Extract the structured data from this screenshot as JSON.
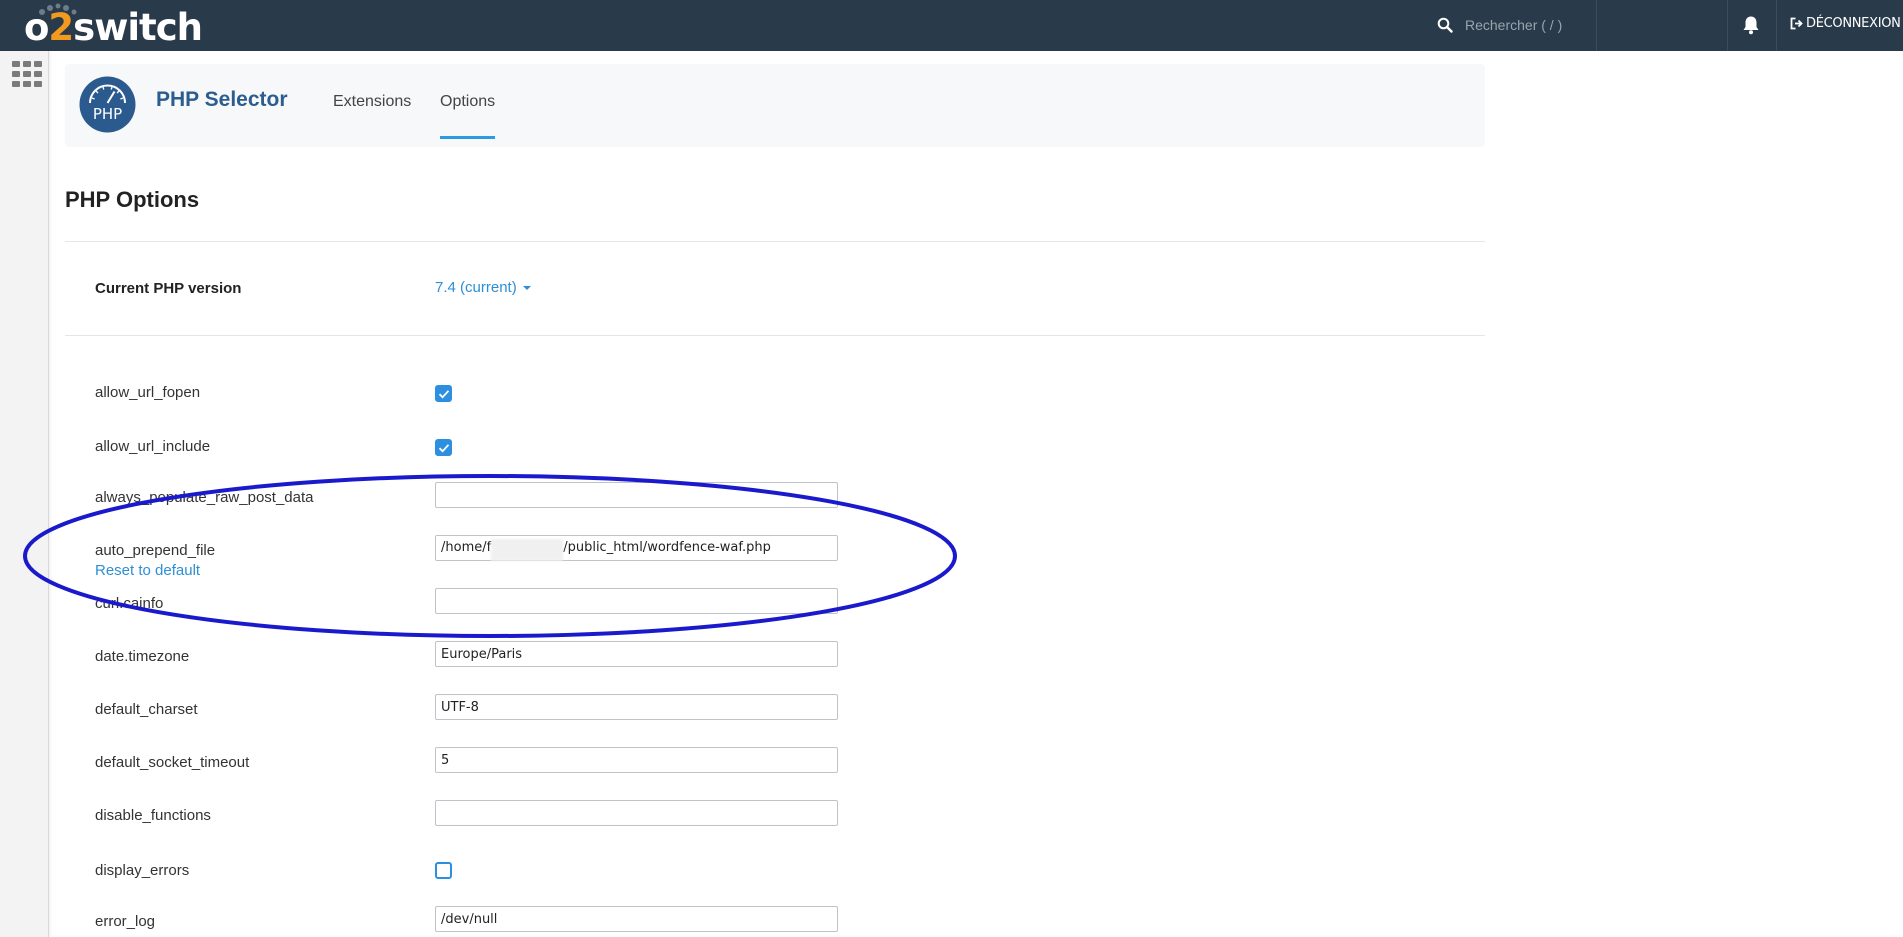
{
  "brand": {
    "logo_pre": "o",
    "logo_two": "2",
    "logo_post": "switch"
  },
  "topbar": {
    "search_placeholder": "Rechercher ( / )",
    "logout_label": "DÉCONNEXION"
  },
  "header": {
    "logo_text": "PHP",
    "title": "PHP Selector",
    "tabs": [
      {
        "label": "Extensions"
      },
      {
        "label": "Options"
      }
    ]
  },
  "page": {
    "title": "PHP Options",
    "version_label": "Current PHP version",
    "version_value": "7.4 (current)"
  },
  "options": [
    {
      "name": "allow_url_fopen",
      "type": "checkbox",
      "checked": true
    },
    {
      "name": "allow_url_include",
      "type": "checkbox",
      "checked": true
    },
    {
      "name": "always_populate_raw_post_data",
      "type": "text",
      "value": ""
    },
    {
      "name": "auto_prepend_file",
      "type": "text",
      "value_prefix": "/home/f",
      "value_suffix": "/public_html/wordfence-waf.php",
      "reset_label": "Reset to default"
    },
    {
      "name": "curl.cainfo",
      "type": "text",
      "value": ""
    },
    {
      "name": "date.timezone",
      "type": "text",
      "value": "Europe/Paris"
    },
    {
      "name": "default_charset",
      "type": "text",
      "value": "UTF-8"
    },
    {
      "name": "default_socket_timeout",
      "type": "text",
      "value": "5"
    },
    {
      "name": "disable_functions",
      "type": "text",
      "value": ""
    },
    {
      "name": "display_errors",
      "type": "checkbox",
      "checked": false
    },
    {
      "name": "error_log",
      "type": "text",
      "value": "/dev/null"
    }
  ],
  "colors": {
    "topbar": "#293a4a",
    "brand_accent": "#f29a1f",
    "link": "#2d8fd5",
    "annotation_ellipse": "#1a1acc"
  }
}
